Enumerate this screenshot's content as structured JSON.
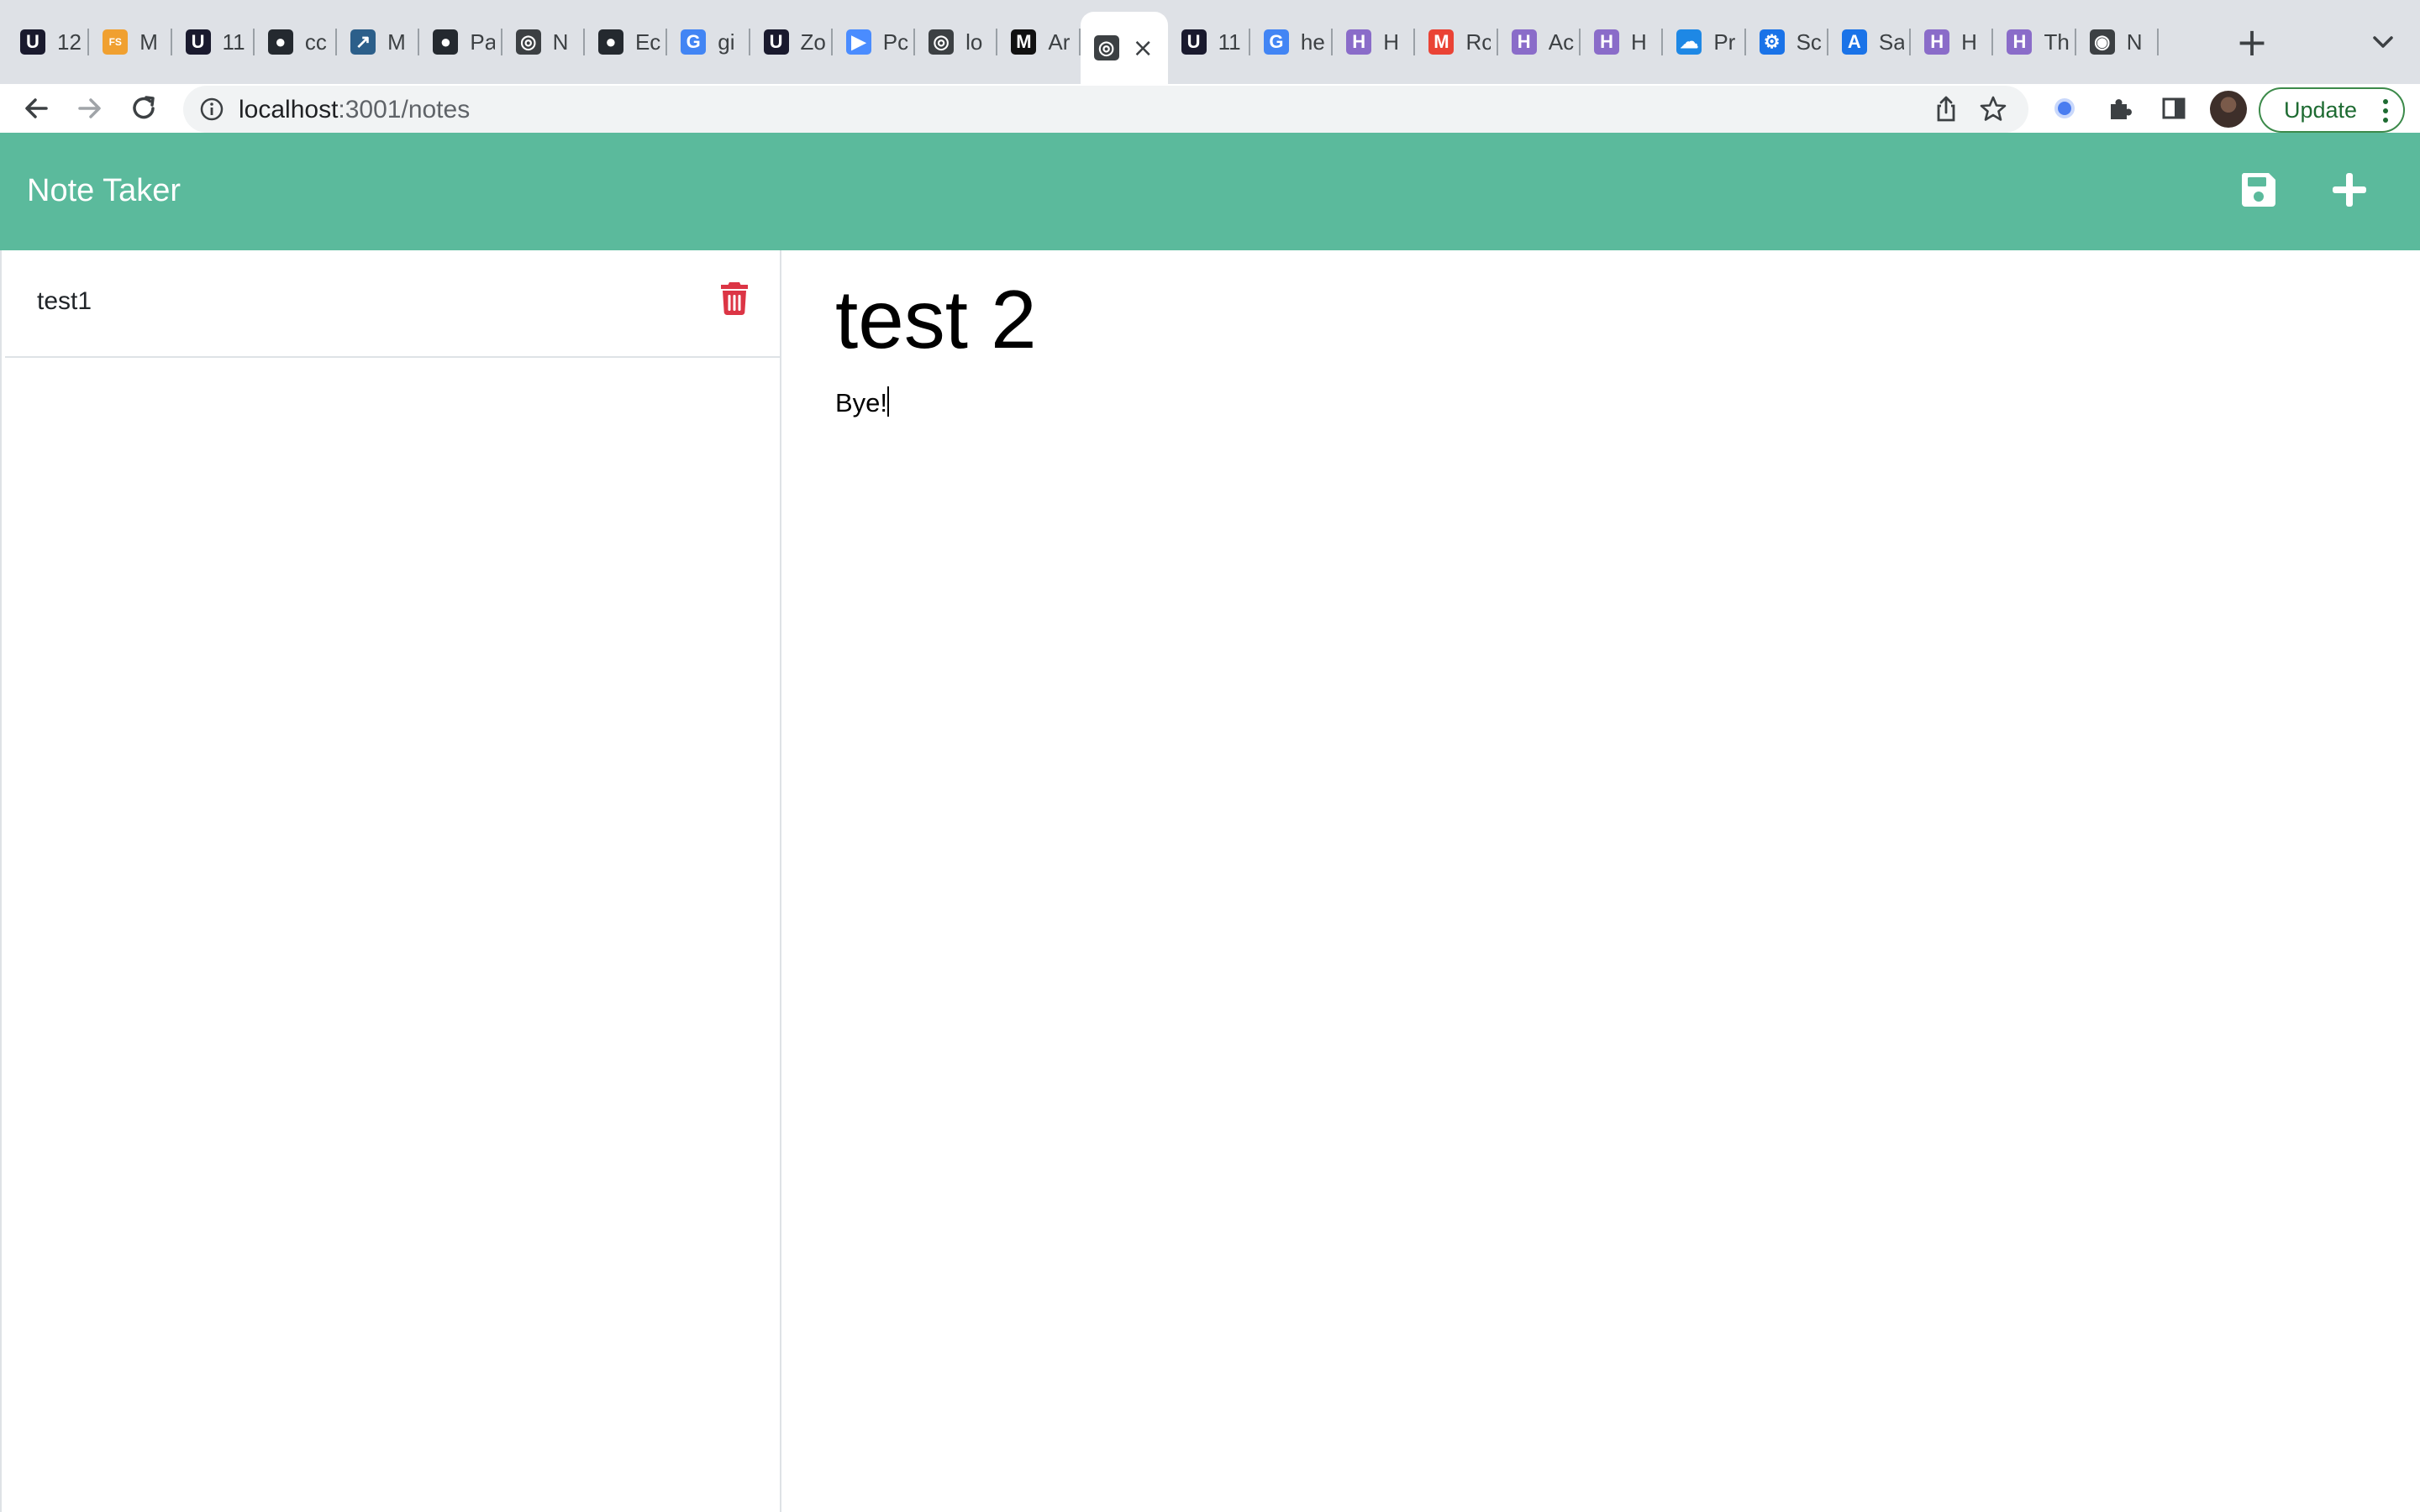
{
  "browser": {
    "tabs": [
      {
        "label": "12",
        "icon": "u-logo-icon",
        "color": "#1a1a2e"
      },
      {
        "label": "M",
        "icon": "fs-logo-icon",
        "color": "#f0a030"
      },
      {
        "label": "11",
        "icon": "u-logo-icon",
        "color": "#1a1a2e"
      },
      {
        "label": "cc",
        "icon": "github-icon",
        "color": "#24292f"
      },
      {
        "label": "M",
        "icon": "bookmark-tab-icon",
        "color": "#2c5f8a"
      },
      {
        "label": "Pa",
        "icon": "github-icon",
        "color": "#24292f"
      },
      {
        "label": "N",
        "icon": "globe-icon",
        "color": "#3c4043"
      },
      {
        "label": "Ec",
        "icon": "github-icon",
        "color": "#24292f"
      },
      {
        "label": "gi",
        "icon": "google-icon",
        "color": "#4285f4"
      },
      {
        "label": "Zo",
        "icon": "u-logo-icon",
        "color": "#1a1a2e"
      },
      {
        "label": "Pc",
        "icon": "zoom-icon",
        "color": "#4a8cff"
      },
      {
        "label": "lo",
        "icon": "globe-icon",
        "color": "#3c4043"
      },
      {
        "label": "Ar",
        "icon": "m-logo-icon",
        "color": "#111111"
      },
      {
        "label": "",
        "icon": "globe-icon",
        "color": "#3c4043",
        "active": true
      },
      {
        "label": "11",
        "icon": "u-logo-icon",
        "color": "#1a1a2e"
      },
      {
        "label": "he",
        "icon": "google-icon",
        "color": "#4285f4"
      },
      {
        "label": "H",
        "icon": "h-logo-icon",
        "color": "#8a6cc9"
      },
      {
        "label": "Rc",
        "icon": "gmail-icon",
        "color": "#ea4335"
      },
      {
        "label": "Ac",
        "icon": "h-logo-icon",
        "color": "#8a6cc9"
      },
      {
        "label": "H",
        "icon": "h-logo-icon",
        "color": "#8a6cc9"
      },
      {
        "label": "Pr",
        "icon": "cloud-icon",
        "color": "#1e88e5"
      },
      {
        "label": "Sc",
        "icon": "gear-icon",
        "color": "#1a73e8"
      },
      {
        "label": "Sa",
        "icon": "app-store-icon",
        "color": "#1a73e8"
      },
      {
        "label": "H",
        "icon": "h-logo-icon",
        "color": "#8a6cc9"
      },
      {
        "label": "Th",
        "icon": "h-logo-icon",
        "color": "#8a6cc9"
      },
      {
        "label": "N",
        "icon": "chrome-icon",
        "color": "#3c4043"
      }
    ],
    "address": {
      "host": "localhost",
      "path": ":3001/notes"
    },
    "update_label": "Update"
  },
  "app": {
    "brand": "Note Taker",
    "colors": {
      "navbar": "#5bba9c",
      "delete": "#dc3545"
    }
  },
  "notes": [
    {
      "title": "test1"
    }
  ],
  "editor": {
    "title": "test 2",
    "body": "Bye!"
  }
}
